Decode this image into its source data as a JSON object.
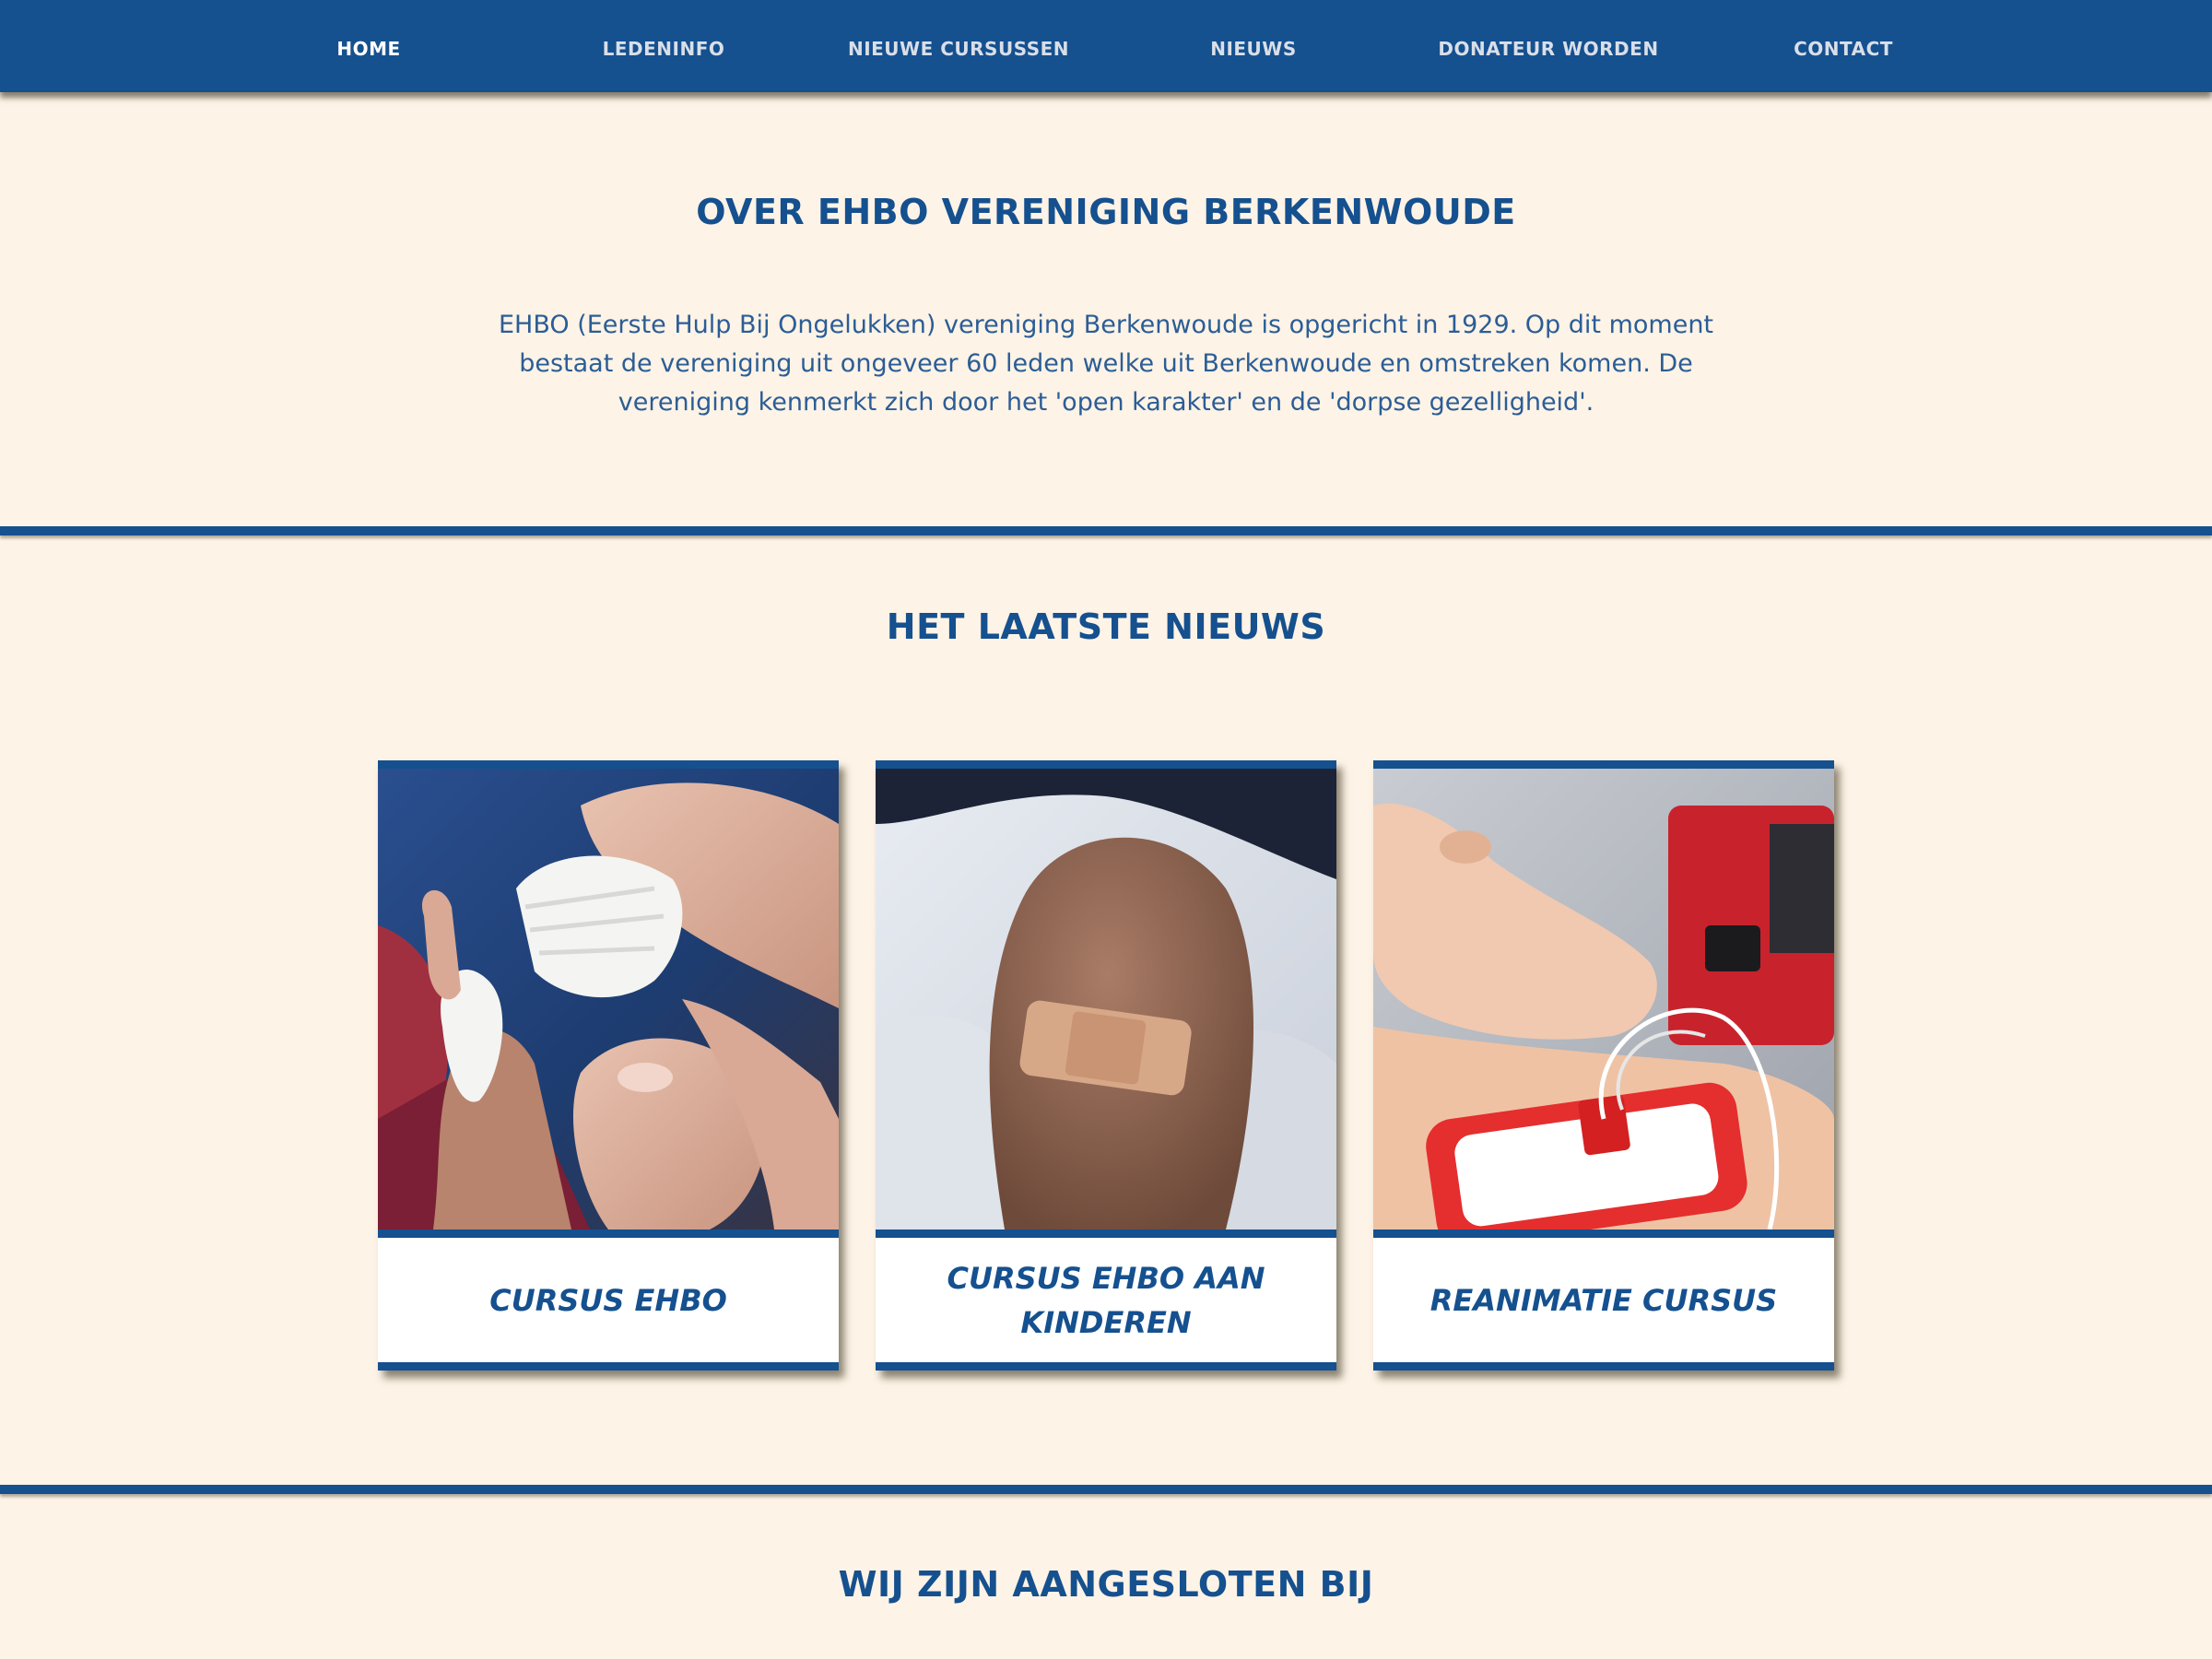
{
  "nav": {
    "items": [
      {
        "label": "HOME",
        "active": true
      },
      {
        "label": "LEDENINFO",
        "active": false
      },
      {
        "label": "NIEUWE CURSUSSEN",
        "active": false
      },
      {
        "label": "NIEUWS",
        "active": false
      },
      {
        "label": "DONATEUR WORDEN",
        "active": false
      },
      {
        "label": "CONTACT",
        "active": false
      }
    ]
  },
  "about": {
    "title": "OVER EHBO VERENIGING BERKENWOUDE",
    "text": "EHBO (Eerste Hulp Bij Ongelukken) vereniging Berkenwoude is opgericht in 1929. Op dit moment bestaat de vereniging uit ongeveer 60 leden welke uit Berkenwoude en omstreken komen. De vereniging kenmerkt zich door het 'open karakter' en de 'dorpse gezelligheid'."
  },
  "news": {
    "title": "HET LAATSTE NIEUWS",
    "cards": [
      {
        "title": "CURSUS EHBO",
        "image": "bandaging-hand-photo"
      },
      {
        "title": "CURSUS EHBO AAN KINDEREN",
        "image": "knee-plaster-photo"
      },
      {
        "title": "REANIMATIE CURSUS",
        "image": "cpr-manikin-aed-photo"
      }
    ]
  },
  "affiliations": {
    "title": "WIJ ZIJN AANGESLOTEN BIJ"
  },
  "colors": {
    "primary": "#15508f",
    "background": "#fdf3e6",
    "card": "#ffffff"
  }
}
